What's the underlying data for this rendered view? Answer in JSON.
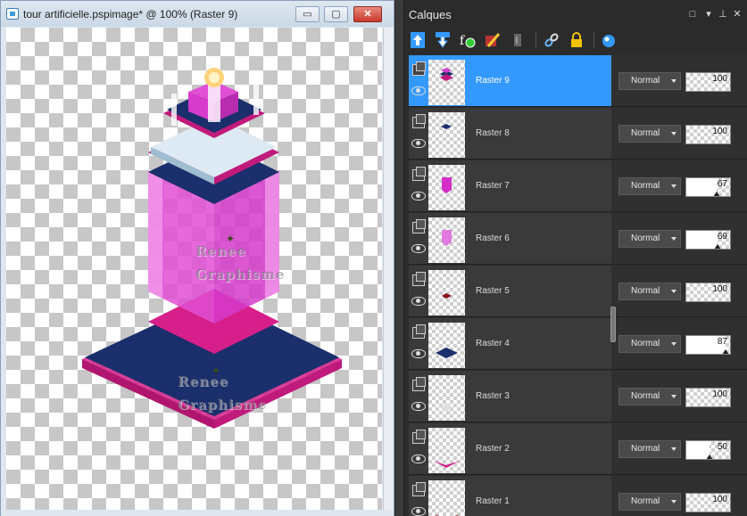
{
  "image_window": {
    "title": "tour artificielle.pspimage* @ 100% (Raster 9)",
    "buttons": {
      "minimize": "▭",
      "maximize": "▢",
      "close": "✕"
    },
    "watermark_line1": "Renee",
    "watermark_line2": "Graphisme"
  },
  "layers_panel": {
    "title": "Calques",
    "toolbar_icons": [
      "new-raster-layer-icon",
      "new-vector-layer-icon",
      "new-adjustment-layer-icon",
      "new-mask-layer-icon",
      "delete-mask-icon",
      "link-layers-icon",
      "lock-transparency-icon",
      "layer-styles-icon"
    ],
    "layers": [
      {
        "name": "Raster 9",
        "blend": "Normal",
        "opacity": 100,
        "selected": true,
        "thumb": "stack"
      },
      {
        "name": "Raster 8",
        "blend": "Normal",
        "opacity": 100,
        "selected": false,
        "thumb": "dot-navy"
      },
      {
        "name": "Raster 7",
        "blend": "Normal",
        "opacity": 67,
        "selected": false,
        "thumb": "box-magenta"
      },
      {
        "name": "Raster 6",
        "blend": "Normal",
        "opacity": 69,
        "selected": false,
        "thumb": "box-pink"
      },
      {
        "name": "Raster 5",
        "blend": "Normal",
        "opacity": 100,
        "selected": false,
        "thumb": "dot-maroon"
      },
      {
        "name": "Raster 4",
        "blend": "Normal",
        "opacity": 87,
        "selected": false,
        "thumb": "diamond-navy"
      },
      {
        "name": "Raster 3",
        "blend": "Normal",
        "opacity": 100,
        "selected": false,
        "thumb": "faint"
      },
      {
        "name": "Raster 2",
        "blend": "Normal",
        "opacity": 50,
        "selected": false,
        "thumb": "wedge-magenta"
      },
      {
        "name": "Raster 1",
        "blend": "Normal",
        "opacity": 100,
        "selected": false,
        "thumb": "wedge-maroon"
      }
    ]
  },
  "colors": {
    "selected": "#3399ff",
    "magenta": "#d61f8a",
    "navy": "#1a2f6b",
    "pink": "#e14fd4"
  }
}
